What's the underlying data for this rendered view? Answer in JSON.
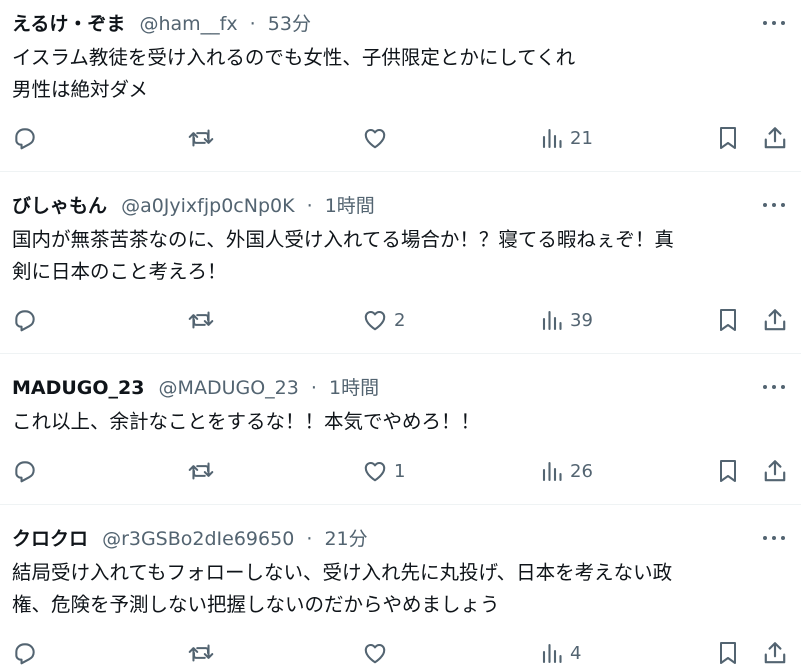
{
  "tweets": [
    {
      "name": "えるけ・ぞま",
      "handle": "@ham__fx",
      "separator": "·",
      "time": "53分",
      "text_lines": [
        "イスラム教徒を受け入れるのでも女性、子供限定とかにしてくれ",
        "男性は絶対ダメ"
      ],
      "likes": "",
      "views": "21"
    },
    {
      "name": "びしゃもん",
      "handle": "@a0Jyixfjp0cNp0K",
      "separator": "·",
      "time": "1時間",
      "text_lines": [
        "国内が無茶苦茶なのに、外国人受け入れてる場合か！？寝てる暇ねぇぞ！真",
        "剣に日本のこと考えろ！"
      ],
      "likes": "2",
      "views": "39"
    },
    {
      "name": "MADUGO_23",
      "handle": "@MADUGO_23",
      "separator": "·",
      "time": "1時間",
      "text_lines": [
        "これ以上、余計なことをするな！！本気でやめろ！！"
      ],
      "likes": "1",
      "views": "26"
    },
    {
      "name": "クロクロ",
      "handle": "@r3GSBo2dIe69650",
      "separator": "·",
      "time": "21分",
      "text_lines": [
        "結局受け入れてもフォローしない、受け入れ先に丸投げ、日本を考えない政",
        "権、危険を予測しない把握しないのだからやめましょう"
      ],
      "likes": "",
      "views": "4"
    }
  ],
  "icons": {
    "more": "more-horizontal-icon",
    "reply": "reply-icon",
    "repost": "repost-icon",
    "like": "like-icon",
    "views": "views-icon",
    "bookmark": "bookmark-icon",
    "share": "share-icon"
  },
  "colors": {
    "text": "#0f1419",
    "secondary": "#536471",
    "divider": "#eff3f4",
    "background": "#ffffff"
  }
}
